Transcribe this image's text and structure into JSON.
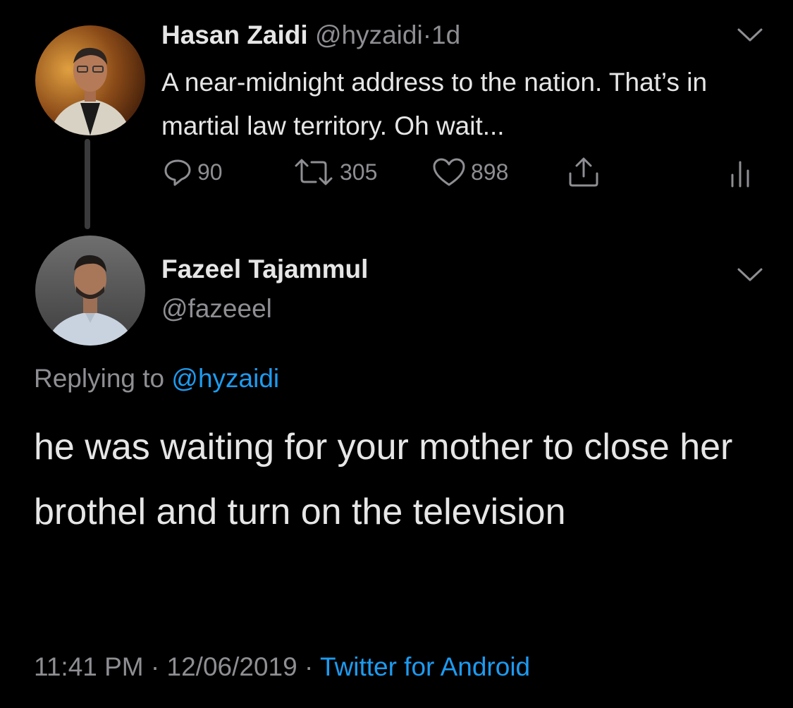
{
  "parent_tweet": {
    "author_name": "Hasan Zaidi",
    "author_handle": "@hyzaidi",
    "separator": "·",
    "time": "1d",
    "text": "A near-midnight address to the nation. That’s in martial law territory. Oh wait...",
    "replies": "90",
    "retweets": "305",
    "likes": "898"
  },
  "reply_tweet": {
    "author_name": "Fazeel Tajammul",
    "author_handle": "@fazeeel",
    "replying_label": "Replying to",
    "replying_to": "@hyzaidi",
    "text": "he was waiting for your mother to close her brothel and turn on the television",
    "time": "11:41 PM",
    "separator1": "·",
    "date": "12/06/2019",
    "separator2": "·",
    "source": "Twitter for Android"
  },
  "icons": {
    "reply": "reply-icon",
    "retweet": "retweet-icon",
    "like": "heart-icon",
    "share": "share-icon",
    "analytics": "analytics-icon",
    "menu": "chevron-down-icon"
  },
  "colors": {
    "background": "#000000",
    "text_primary": "#e6e6e6",
    "text_secondary": "#8e8e93",
    "link": "#1d9bf0"
  }
}
